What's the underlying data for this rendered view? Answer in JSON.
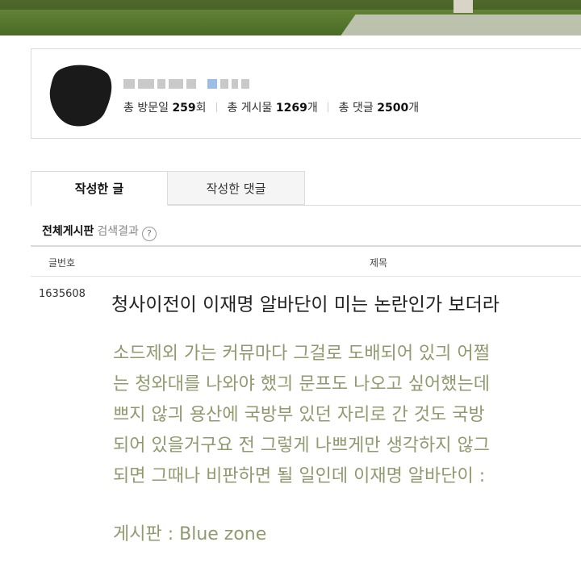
{
  "profile": {
    "stats": {
      "visits_label": "총 방문일",
      "visits_value": "259",
      "visits_unit": "회",
      "posts_label": "총 게시물",
      "posts_value": "1269",
      "posts_unit": "개",
      "comments_label": "총 댓글",
      "comments_value": "2500",
      "comments_unit": "개"
    }
  },
  "tabs": [
    {
      "label": "작성한 글"
    },
    {
      "label": "작성한 댓글"
    }
  ],
  "breadcrumb": {
    "board": "전체게시판",
    "sub": "검색결과",
    "help_glyph": "?"
  },
  "table": {
    "columns": [
      "글번호",
      "제목"
    ],
    "rows": [
      {
        "number": "1635608",
        "title": "청사이전이 이재명 알바단이 미는 논란인가 보더라",
        "excerpt": [
          "소드제외 가는 커뮤마다 그걸로 도배되어 있긔 어쩔",
          "는 청와대를 나와야 했긔 문프도 나오고 싶어했는데",
          "쁘지 않긔 용산에 국방부 있던 자리로 간 것도 국방",
          "되어 있을거구요 전 그렇게 나쁘게만 생각하지 않그",
          "되면 그때나 비판하면 될 일인데 이재명 알바단이 :"
        ],
        "board": "게시판 : Blue zone"
      }
    ]
  }
}
